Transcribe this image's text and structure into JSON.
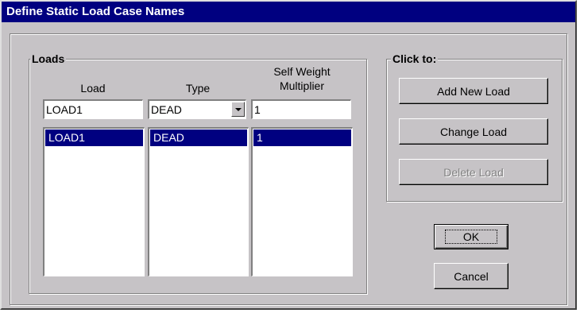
{
  "window": {
    "title": "Define Static Load Case Names"
  },
  "loads_group": {
    "legend": "Loads",
    "columns": {
      "load": "Load",
      "type": "Type",
      "multiplier_line1": "Self Weight",
      "multiplier_line2": "Multiplier"
    },
    "inputs": {
      "load_value": "LOAD1",
      "type_value": "DEAD",
      "multiplier_value": "1"
    },
    "rows": [
      {
        "load": "LOAD1",
        "type": "DEAD",
        "multiplier": "1"
      }
    ]
  },
  "click_group": {
    "legend": "Click to:",
    "add_label": "Add New Load",
    "change_label": "Change Load",
    "delete_label": "Delete Load"
  },
  "buttons": {
    "ok": "OK",
    "cancel": "Cancel"
  },
  "colors": {
    "titlebar": "#000080",
    "face": "#c6c3c6",
    "selection": "#000080"
  }
}
